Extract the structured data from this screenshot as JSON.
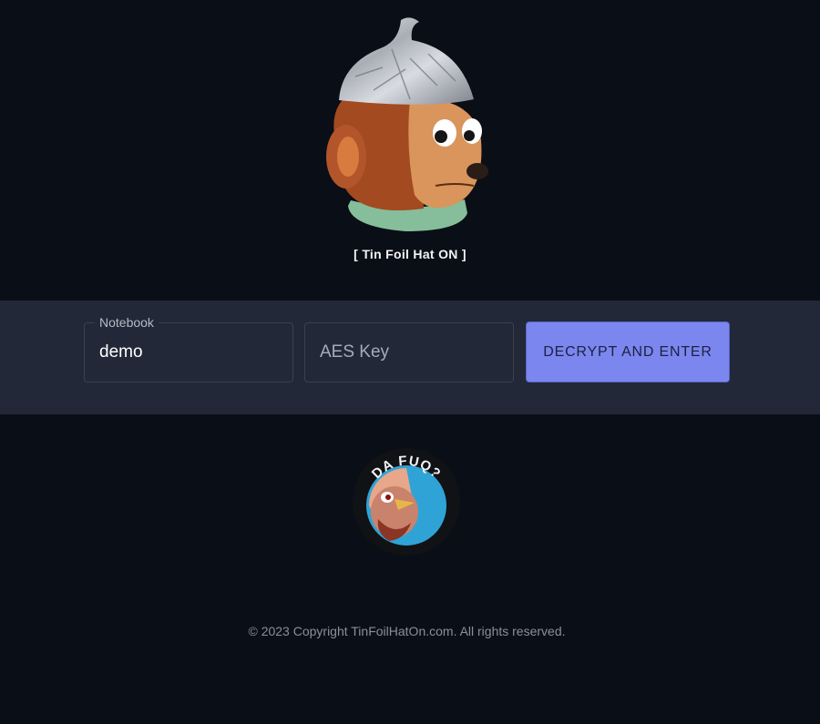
{
  "hero": {
    "mascot_icon": "tinfoil-hat-monkey-icon",
    "tagline": "[ Tin Foil Hat ON ]"
  },
  "login": {
    "notebook_label": "Notebook",
    "notebook_value": "demo",
    "aes_key_placeholder": "AES Key",
    "aes_key_value": "",
    "submit_label": "DECRYPT AND ENTER"
  },
  "badge": {
    "icon": "da-fuq-turkey-badge-icon",
    "text": "DA FUQ?"
  },
  "footer": {
    "copyright": "© 2023 Copyright TinFoilHatOn.com. All rights reserved."
  },
  "colors": {
    "background": "#0a0e17",
    "band": "#222837",
    "accent": "#7b86ef"
  }
}
